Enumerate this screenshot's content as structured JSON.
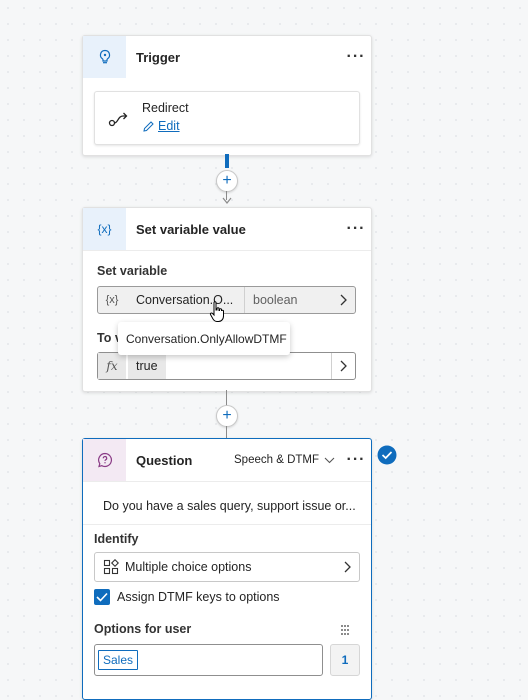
{
  "trigger": {
    "title": "Trigger",
    "more": "···",
    "redirect": {
      "label": "Redirect",
      "edit": "Edit"
    }
  },
  "set_variable": {
    "title": "Set variable value",
    "icon_text": "{x}",
    "more": "···",
    "set_variable_label": "Set variable",
    "var_prefix": "{x}",
    "var_name": "Conversation.O...",
    "var_type": "boolean",
    "to_value_label": "To v",
    "value_prefix": "fx",
    "value": "true",
    "tooltip": "Conversation.OnlyAllowDTMF"
  },
  "question": {
    "title": "Question",
    "mode": "Speech & DTMF",
    "more": "···",
    "prompt": "Do you have a sales query, support issue or...",
    "identify_label": "Identify",
    "identify_value": "Multiple choice options",
    "dtmf_checkbox_label": "Assign DTMF keys to options",
    "dtmf_checked": true,
    "options_label": "Options for user",
    "option_value": "Sales",
    "option_key": "1"
  },
  "colors": {
    "accent": "#0f6cbd",
    "trigger_icon_bg": "#e8f1fb",
    "question_icon_bg": "#f3e9f3",
    "question_border": "#0f6cbd"
  },
  "icons": [
    "lightbulb-icon",
    "redirect-icon",
    "pencil-icon",
    "variable-icon",
    "chevron-right-icon",
    "function-icon",
    "question-icon",
    "chevron-down-icon",
    "check-circle-icon",
    "multiple-choice-icon",
    "drag-handle-icon",
    "mouse-cursor-icon",
    "plus-icon"
  ]
}
